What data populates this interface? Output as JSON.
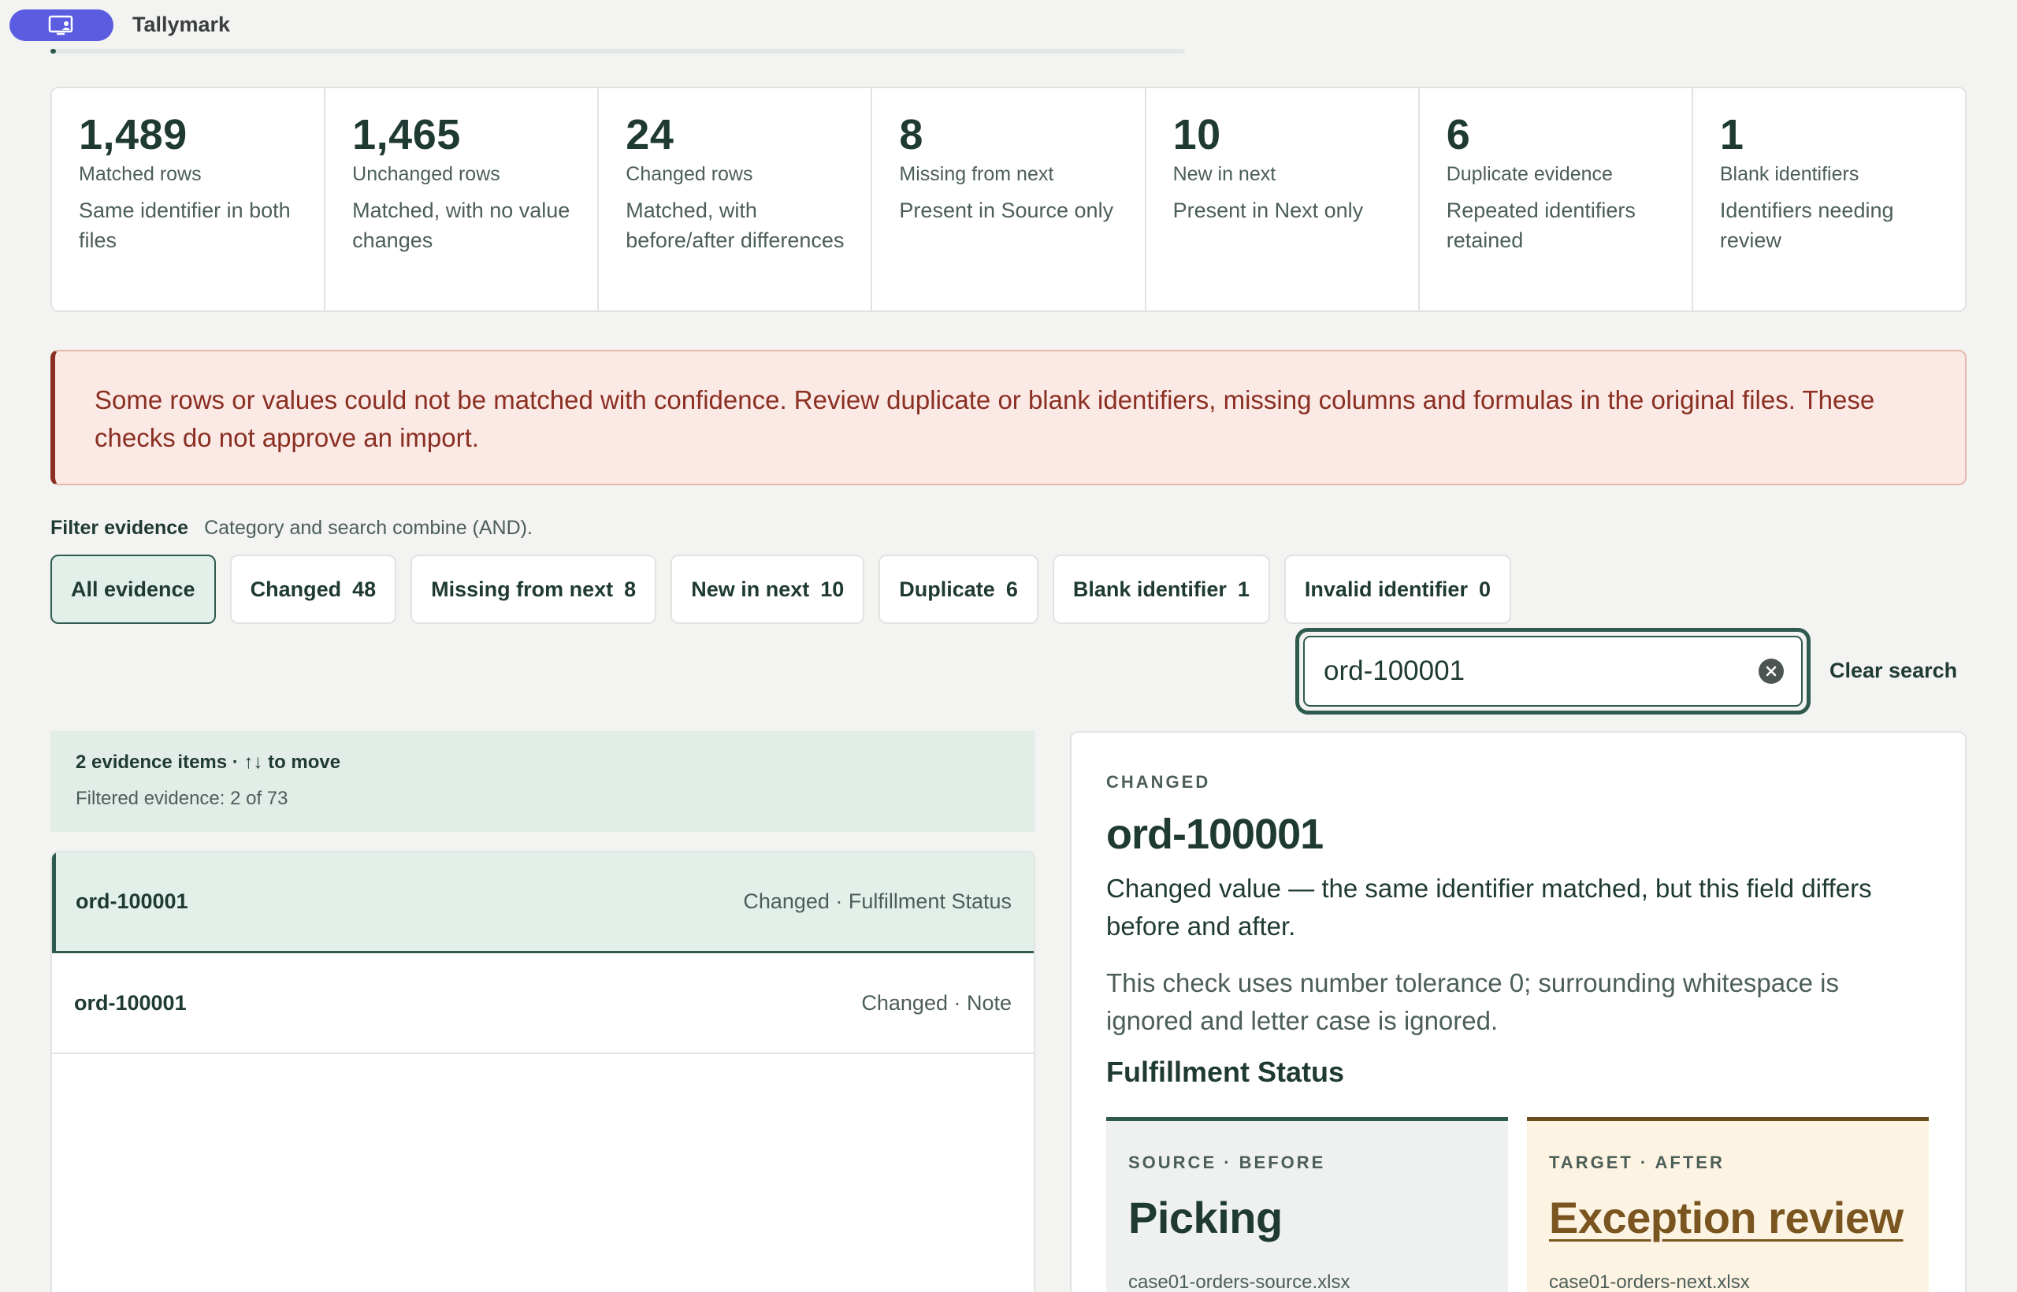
{
  "app": {
    "title": "Tallymark",
    "progress_fraction": 0.005
  },
  "stats": [
    {
      "value": "1,489",
      "label": "Matched rows",
      "desc": "Same identifier in both files"
    },
    {
      "value": "1,465",
      "label": "Unchanged rows",
      "desc": "Matched, with no value changes"
    },
    {
      "value": "24",
      "label": "Changed rows",
      "desc": "Matched, with before/after differences"
    },
    {
      "value": "8",
      "label": "Missing from next",
      "desc": "Present in Source only"
    },
    {
      "value": "10",
      "label": "New in next",
      "desc": "Present in Next only"
    },
    {
      "value": "6",
      "label": "Duplicate evidence",
      "desc": "Repeated identifiers retained"
    },
    {
      "value": "1",
      "label": "Blank identifiers",
      "desc": "Identifiers needing review"
    }
  ],
  "warning": "Some rows or values could not be matched with confidence. Review duplicate or blank identifiers, missing columns and formulas in the original files. These checks do not approve an import.",
  "filter": {
    "title": "Filter evidence",
    "hint": "Category and search combine (AND).",
    "chips": [
      {
        "label": "All evidence",
        "count": ""
      },
      {
        "label": "Changed",
        "count": "48"
      },
      {
        "label": "Missing from next",
        "count": "8"
      },
      {
        "label": "New in next",
        "count": "10"
      },
      {
        "label": "Duplicate",
        "count": "6"
      },
      {
        "label": "Blank identifier",
        "count": "1"
      },
      {
        "label": "Invalid identifier",
        "count": "0"
      }
    ]
  },
  "search": {
    "value": "ord-100001",
    "clear_label": "Clear search"
  },
  "list": {
    "count_text": "2 evidence items · ↑↓ to move",
    "filtered_text": "Filtered evidence: 2 of 73",
    "rows": [
      {
        "id": "ord-100001",
        "meta": "Changed · Fulfillment Status"
      },
      {
        "id": "ord-100001",
        "meta": "Changed · Note"
      }
    ]
  },
  "detail": {
    "kicker": "CHANGED",
    "title": "ord-100001",
    "desc": "Changed value — the same identifier matched, but this field differs before and after.",
    "note": "This check uses number tolerance 0; surrounding whitespace is ignored and letter case is ignored.",
    "field": "Fulfillment Status",
    "before": {
      "label": "SOURCE · BEFORE",
      "value": "Picking",
      "file": "case01-orders-source.xlsx"
    },
    "after": {
      "label": "TARGET · AFTER",
      "value": "Exception review",
      "file": "case01-orders-next.xlsx"
    }
  },
  "colors": {
    "brand": "#5b5ce0",
    "accent": "#2f5a50",
    "warning": "#8a2f22",
    "after": "#7a5520"
  }
}
